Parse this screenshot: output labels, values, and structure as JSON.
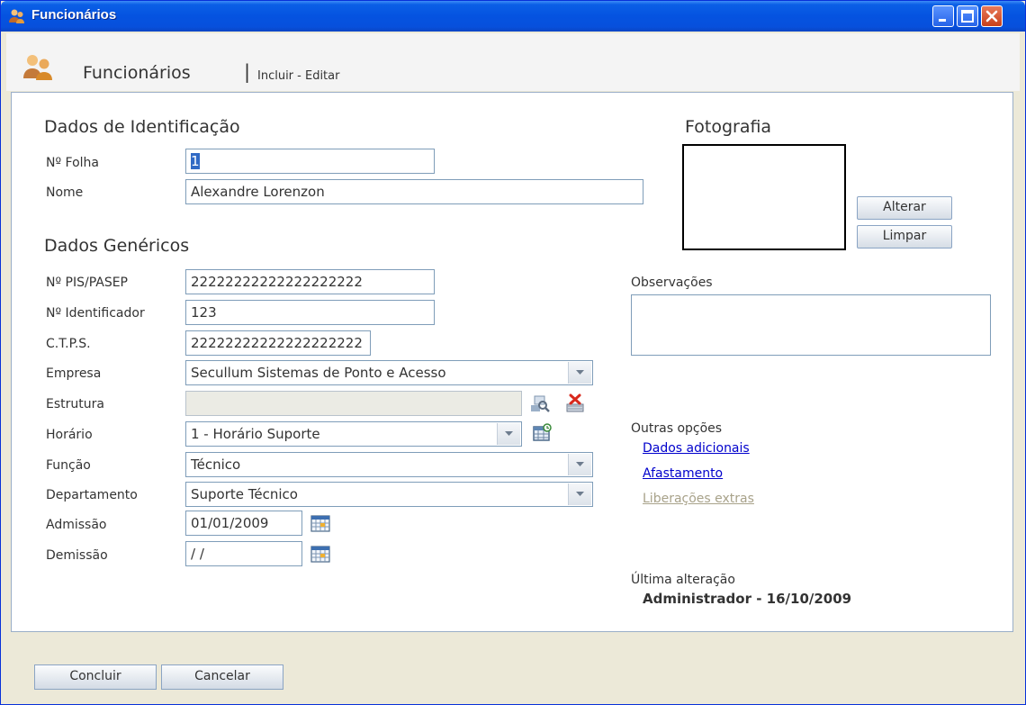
{
  "window": {
    "title": "Funcionários"
  },
  "header": {
    "title": "Funcionários",
    "separator": "|",
    "subtitle": "Incluir - Editar"
  },
  "identificacao": {
    "heading": "Dados de Identificação",
    "folha_label": "Nº Folha",
    "folha_value": "1",
    "nome_label": "Nome",
    "nome_value": "Alexandre Lorenzon"
  },
  "genericos": {
    "heading": "Dados Genéricos",
    "pis_label": "Nº PIS/PASEP",
    "pis_value": "22222222222222222222",
    "identificador_label": "Nº Identificador",
    "identificador_value": "123",
    "ctps_label": "C.T.P.S.",
    "ctps_value": "22222222222222222222",
    "empresa_label": "Empresa",
    "empresa_value": "Secullum Sistemas de Ponto e Acesso",
    "estrutura_label": "Estrutura",
    "estrutura_value": "",
    "horario_label": "Horário",
    "horario_value": "1 - Horário Suporte",
    "funcao_label": "Função",
    "funcao_value": "Técnico",
    "departamento_label": "Departamento",
    "departamento_value": "Suporte Técnico",
    "admissao_label": "Admissão",
    "admissao_value": "01/01/2009",
    "demissao_label": "Demissão",
    "demissao_value": " / /"
  },
  "fotografia": {
    "heading": "Fotografia",
    "alterar_label": "Alterar",
    "limpar_label": "Limpar"
  },
  "observacoes": {
    "label": "Observações",
    "value": ""
  },
  "outras": {
    "label": "Outras opções",
    "dados_adicionais": "Dados adicionais",
    "afastamento": "Afastamento",
    "liberacoes": "Liberações extras"
  },
  "ultima": {
    "label": "Última alteração",
    "value": "Administrador - 16/10/2009"
  },
  "footer": {
    "concluir_label": "Concluir",
    "cancelar_label": "Cancelar"
  },
  "colors": {
    "titlebar": "#0553e0",
    "link": "#0000cc",
    "link_disabled": "#a8a28a",
    "selection": "#316ac5"
  }
}
